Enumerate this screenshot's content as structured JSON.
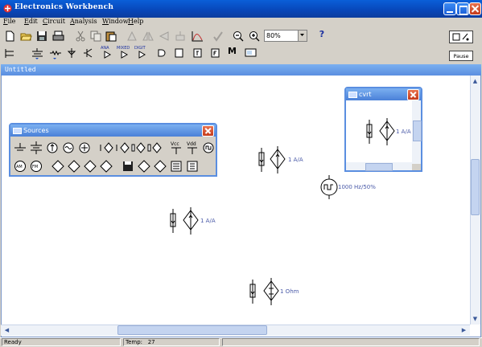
{
  "window": {
    "title": "Electronics Workbench"
  },
  "menu": [
    {
      "label": "File",
      "key": "F",
      "rest": "ile"
    },
    {
      "label": "Edit",
      "key": "E",
      "rest": "dit"
    },
    {
      "label": "Circuit",
      "key": "C",
      "rest": "ircuit"
    },
    {
      "label": "Analysis",
      "key": "A",
      "rest": "nalysis"
    },
    {
      "label": "Window",
      "key": "W",
      "rest": "indow"
    },
    {
      "label": "Help",
      "key": "H",
      "rest": "elp"
    }
  ],
  "toolbar": {
    "zoom_value": "80%",
    "help_label": "?",
    "pause_label": "Pause",
    "parts_labels": {
      "analog": "ANA",
      "mixed": "MIXED",
      "digital": "DIGIT",
      "misc": "M"
    }
  },
  "circuit_window": {
    "title": "Untitled"
  },
  "sources_palette": {
    "title": "Sources",
    "vcc_label": "Vcc",
    "vdd_label": "Vdd"
  },
  "subcircuit_window": {
    "title": "cvrt"
  },
  "components": [
    {
      "kind": "cccs",
      "label": "1 A/A"
    },
    {
      "kind": "clock",
      "label": "1000 Hz/50%"
    },
    {
      "kind": "cccs",
      "label": "1 A/A"
    },
    {
      "kind": "ccvs",
      "label": "1 Ohm"
    }
  ],
  "subcircuit_component": {
    "label": "1 A/A"
  },
  "status": {
    "left": "Ready",
    "temp_label": "Temp:",
    "temp_value": "27"
  },
  "colors": {
    "titlebar": "#0846b8",
    "circuit_title": "#6a9ee8",
    "label": "#4a5aa8"
  }
}
